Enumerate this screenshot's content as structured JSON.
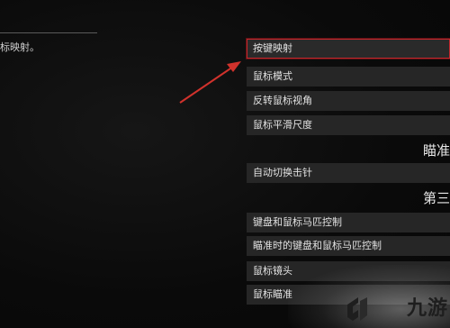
{
  "left_panel": {
    "description": "标映射。"
  },
  "menu": {
    "items": [
      {
        "label": "按键映射",
        "selected": true
      },
      {
        "label": "鼠标模式"
      },
      {
        "label": "反转鼠标视角"
      },
      {
        "label": "鼠标平滑尺度"
      },
      {
        "label": "自动切换击针"
      },
      {
        "label": "键盘和鼠标马匹控制"
      },
      {
        "label": "瞄准时的键盘和鼠标马匹控制"
      },
      {
        "label": "鼠标镜头"
      },
      {
        "label": "鼠标瞄准"
      }
    ],
    "sections": [
      {
        "title": "瞄准"
      },
      {
        "title": "第三"
      }
    ]
  },
  "watermark": {
    "text": "九游"
  },
  "colors": {
    "highlight": "#c0282d",
    "row_bg": "#262626",
    "arrow": "#d0322c"
  }
}
